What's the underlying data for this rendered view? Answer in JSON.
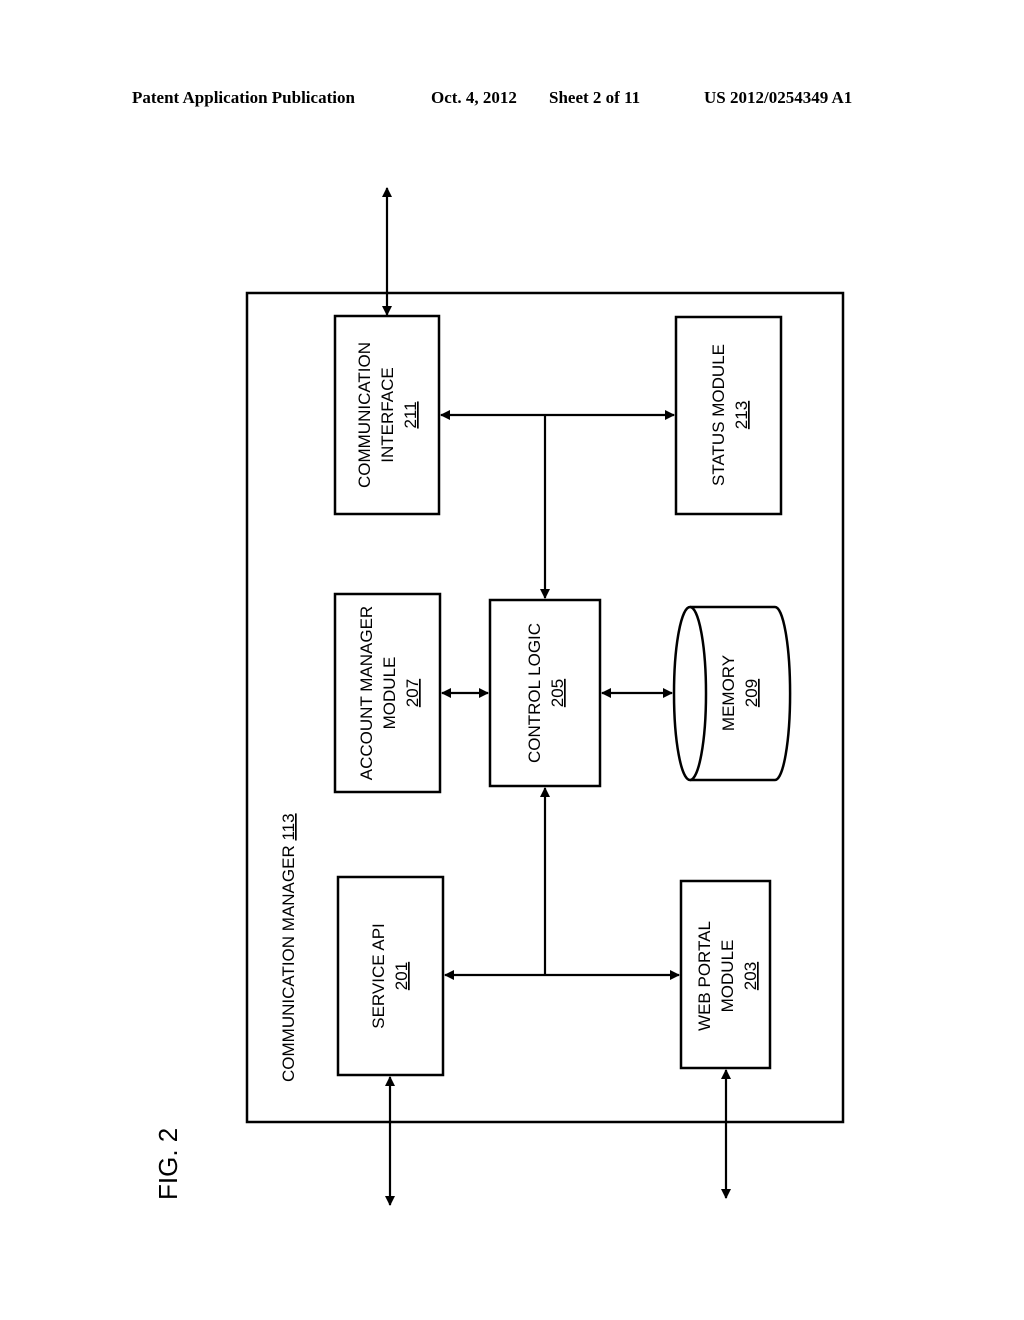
{
  "header": {
    "publication": "Patent Application Publication",
    "date": "Oct. 4, 2012",
    "sheet": "Sheet 2 of 11",
    "number": "US 2012/0254349 A1"
  },
  "figure": {
    "label": "FIG. 2",
    "container": {
      "title": "COMMUNICATION MANAGER",
      "ref": "113"
    },
    "blocks": {
      "communication_interface": {
        "lines": [
          "COMMUNICATION",
          "INTERFACE"
        ],
        "ref": "211"
      },
      "status_module": {
        "lines": [
          "STATUS MODULE"
        ],
        "ref": "213"
      },
      "account_manager_module": {
        "lines": [
          "ACCOUNT MANAGER",
          "MODULE"
        ],
        "ref": "207"
      },
      "control_logic": {
        "lines": [
          "CONTROL LOGIC"
        ],
        "ref": "205"
      },
      "memory": {
        "lines": [
          "MEMORY"
        ],
        "ref": "209"
      },
      "service_api": {
        "lines": [
          "SERVICE API"
        ],
        "ref": "201"
      },
      "web_portal_module": {
        "lines": [
          "WEB PORTAL",
          "MODULE"
        ],
        "ref": "203"
      }
    }
  }
}
